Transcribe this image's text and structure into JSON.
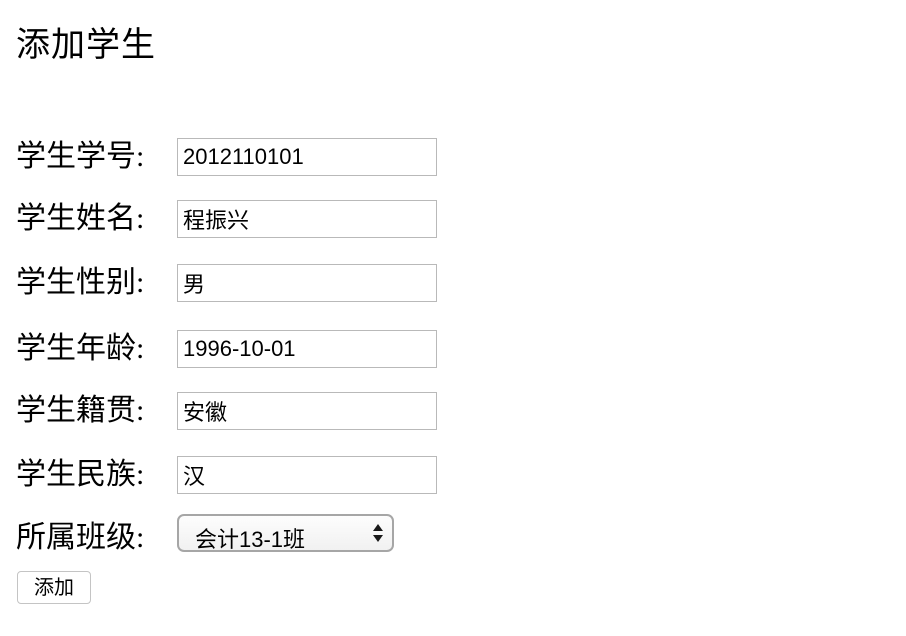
{
  "page": {
    "title": "添加学生"
  },
  "form": {
    "fields": [
      {
        "label": "学生学号:",
        "value": "2012110101"
      },
      {
        "label": "学生姓名:",
        "value": "程振兴"
      },
      {
        "label": "学生性别:",
        "value": "男"
      },
      {
        "label": "学生年龄:",
        "value": "1996-10-01"
      },
      {
        "label": "学生籍贯:",
        "value": "安徽"
      },
      {
        "label": "学生民族:",
        "value": "汉"
      }
    ],
    "class_select": {
      "label": "所属班级:",
      "selected": "会计13-1班"
    },
    "submit_label": "添加"
  }
}
